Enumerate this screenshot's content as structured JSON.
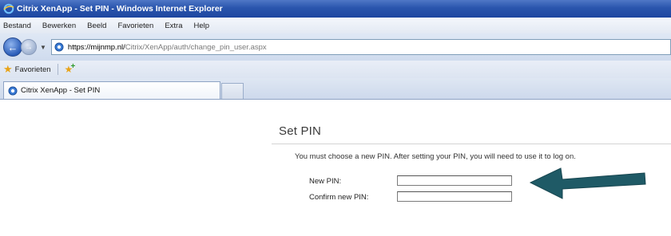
{
  "window": {
    "title": "Citrix XenApp - Set PIN - Windows Internet Explorer",
    "icon": "ie-icon"
  },
  "menu": {
    "items": [
      "Bestand",
      "Bewerken",
      "Beeld",
      "Favorieten",
      "Extra",
      "Help"
    ]
  },
  "address": {
    "url_host": "https://mijnmp.nl/",
    "url_path": "Citrix/XenApp/auth/change_pin_user.aspx"
  },
  "favorites_bar": {
    "label": "Favorieten"
  },
  "tabs": [
    {
      "label": "Citrix XenApp - Set PIN",
      "icon": "globe-icon"
    }
  ],
  "page": {
    "title": "Set PIN",
    "instruction": "You must choose a new PIN. After setting your PIN, you will need to use it to log on.",
    "new_pin_label": "New PIN:",
    "confirm_pin_label": "Confirm new PIN:",
    "new_pin_value": "",
    "confirm_pin_value": ""
  },
  "colors": {
    "titlebar": "#2a55ad",
    "arrow": "#1f5a66"
  }
}
